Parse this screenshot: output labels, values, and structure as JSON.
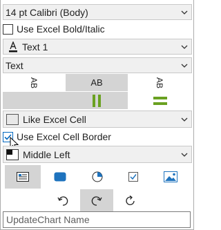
{
  "font_size_dropdown": {
    "value": "14 pt Calibri (Body)"
  },
  "use_bold_italic": {
    "label": "Use Excel Bold/Italic",
    "checked": false
  },
  "text_color_dropdown": {
    "value": "Text 1",
    "icon": "font-color-icon"
  },
  "text_type_dropdown": {
    "value": "Text"
  },
  "orientation": {
    "options": [
      "AB",
      "AB",
      "AB"
    ],
    "selected_index": 1
  },
  "alignment_bars": {
    "selected_index": 1
  },
  "fill_dropdown": {
    "value": "Like Excel Cell",
    "icon": "fill-swatch-icon"
  },
  "use_cell_border": {
    "label": "Use Excel Cell Border",
    "checked": true
  },
  "position_dropdown": {
    "value": "Middle Left",
    "icon": "border-swatch-icon"
  },
  "shape_buttons": [
    "text-box-icon",
    "rounded-rect-icon",
    "pie-icon",
    "checkbox-shape-icon",
    "picture-icon"
  ],
  "rotate_buttons": [
    "rotate-left-icon",
    "rotate-right-icon",
    "refresh-icon"
  ],
  "name_field": {
    "placeholder": "UpdateChart Name",
    "value": ""
  },
  "colors": {
    "accent_green": "#6aa121",
    "selected_bg": "#d4d4d4",
    "blue": "#1e73be"
  }
}
